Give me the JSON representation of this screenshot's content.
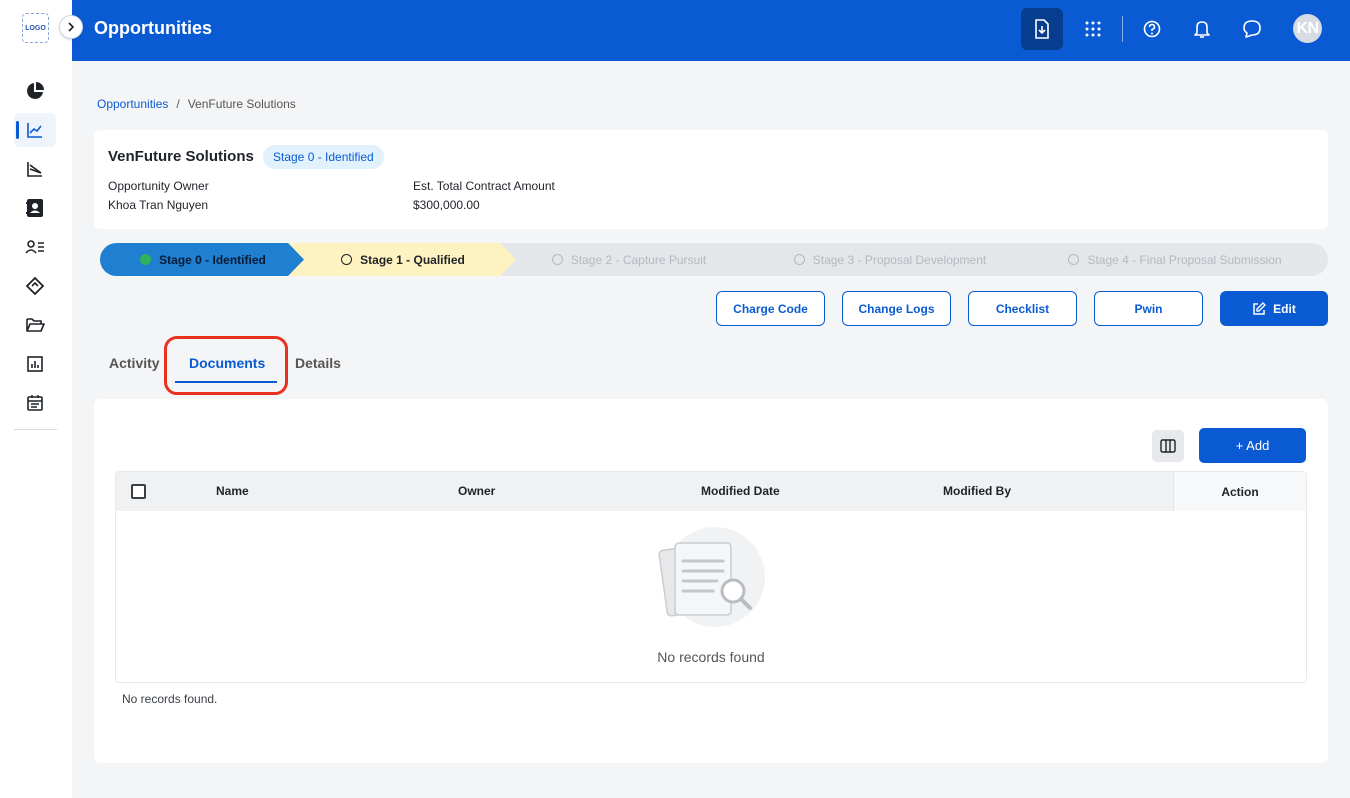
{
  "app": {
    "logo_text": "LOGO",
    "page_title": "Opportunities",
    "avatar_initials": "KN",
    "accent_color": "#0a5bd3"
  },
  "sidebar": {
    "items": [
      {
        "icon": "pie-chart-icon"
      },
      {
        "icon": "trend-chart-icon",
        "active": true
      },
      {
        "icon": "funnel-chart-icon"
      },
      {
        "icon": "contact-card-icon"
      },
      {
        "icon": "user-list-icon"
      },
      {
        "icon": "handshake-icon"
      },
      {
        "icon": "folder-open-icon"
      },
      {
        "icon": "bar-report-icon"
      },
      {
        "icon": "calendar-icon"
      }
    ]
  },
  "header": {
    "icons": [
      "download-file-icon",
      "apps-grid-icon",
      "help-icon",
      "bell-icon",
      "chat-icon"
    ]
  },
  "breadcrumb": {
    "parent": "Opportunities",
    "separator": "/",
    "current": "VenFuture Solutions"
  },
  "summary": {
    "name": "VenFuture Solutions",
    "stage_badge": "Stage 0 - Identified",
    "owner_label": "Opportunity Owner",
    "owner_value": "Khoa Tran Nguyen",
    "amount_label": "Est. Total Contract Amount",
    "amount_value": "$300,000.00"
  },
  "stages": [
    {
      "label": "Stage 0 - Identified",
      "status": "done"
    },
    {
      "label": "Stage 1 - Qualified",
      "status": "current"
    },
    {
      "label": "Stage 2 - Capture Pursuit",
      "status": "future"
    },
    {
      "label": "Stage 3 - Proposal Development",
      "status": "future"
    },
    {
      "label": "Stage 4 - Final Proposal Submission",
      "status": "future"
    }
  ],
  "actions": {
    "charge_code": "Charge Code",
    "change_logs": "Change Logs",
    "checklist": "Checklist",
    "pwin": "Pwin",
    "edit": "Edit"
  },
  "tabs": {
    "activity": "Activity",
    "documents": "Documents",
    "details": "Details"
  },
  "documents": {
    "add_label": "+ Add",
    "columns": {
      "name": "Name",
      "owner": "Owner",
      "modified_date": "Modified Date",
      "modified_by": "Modified By",
      "action": "Action"
    },
    "empty_text": "No records found",
    "footer_text": "No records found."
  }
}
